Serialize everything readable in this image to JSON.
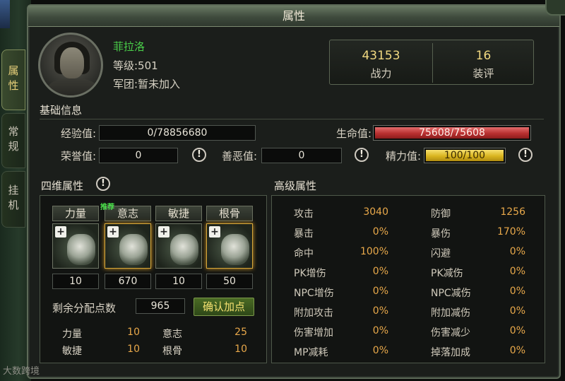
{
  "window": {
    "title": "属性"
  },
  "side_tabs": [
    {
      "label": "属性",
      "active": true
    },
    {
      "label": "常规",
      "active": false
    },
    {
      "label": "挂机",
      "active": false
    }
  ],
  "character": {
    "name": "菲拉洛",
    "level": "等级:501",
    "legion": "军团:暂未加入"
  },
  "power": {
    "value": "43153",
    "label": "战力"
  },
  "gear_score": {
    "value": "16",
    "label": "装评"
  },
  "basic_info": {
    "title": "基础信息",
    "exp_label": "经验值:",
    "exp_value": "0/78856680",
    "hp_label": "生命值:",
    "hp_value": "75608/75608",
    "hp_fraction": 1.0,
    "honor_label": "荣誉值:",
    "honor_value": "0",
    "karma_label": "善恶值:",
    "karma_value": "0",
    "energy_label": "精力值:",
    "energy_value": "100/100",
    "energy_fraction": 1.0
  },
  "four_dim": {
    "title": "四维属性",
    "recommend_tag": "推荐",
    "stats": [
      {
        "label": "力量",
        "value": "10",
        "icon": "strength-icon"
      },
      {
        "label": "意志",
        "value": "670",
        "icon": "will-icon"
      },
      {
        "label": "敏捷",
        "value": "10",
        "icon": "agility-icon"
      },
      {
        "label": "根骨",
        "value": "50",
        "icon": "constitution-icon"
      }
    ],
    "remaining_label": "剩余分配点数",
    "remaining_value": "965",
    "confirm_label": "确认加点",
    "summary": [
      {
        "label": "力量",
        "value": "10"
      },
      {
        "label": "意志",
        "value": "25"
      },
      {
        "label": "敏捷",
        "value": "10"
      },
      {
        "label": "根骨",
        "value": "10"
      }
    ]
  },
  "advanced": {
    "title": "高级属性",
    "rows": [
      {
        "l1": "攻击",
        "v1": "3040",
        "l2": "防御",
        "v2": "1256"
      },
      {
        "l1": "暴击",
        "v1": "0%",
        "l2": "暴伤",
        "v2": "170%"
      },
      {
        "l1": "命中",
        "v1": "100%",
        "l2": "闪避",
        "v2": "0%"
      },
      {
        "l1": "PK增伤",
        "v1": "0%",
        "l2": "PK减伤",
        "v2": "0%"
      },
      {
        "l1": "NPC增伤",
        "v1": "0%",
        "l2": "NPC减伤",
        "v2": "0%"
      },
      {
        "l1": "附加攻击",
        "v1": "0%",
        "l2": "附加减伤",
        "v2": "0%"
      },
      {
        "l1": "伤害增加",
        "v1": "0%",
        "l2": "伤害减少",
        "v2": "0%"
      },
      {
        "l1": "MP减耗",
        "v1": "0%",
        "l2": "掉落加成",
        "v2": "0%"
      }
    ]
  },
  "watermark": "大数跨境",
  "colors": {
    "accent_gold": "#f0d880",
    "hp_red": "#b83030",
    "energy_yellow": "#d9b520",
    "name_green": "#4ad04a"
  }
}
